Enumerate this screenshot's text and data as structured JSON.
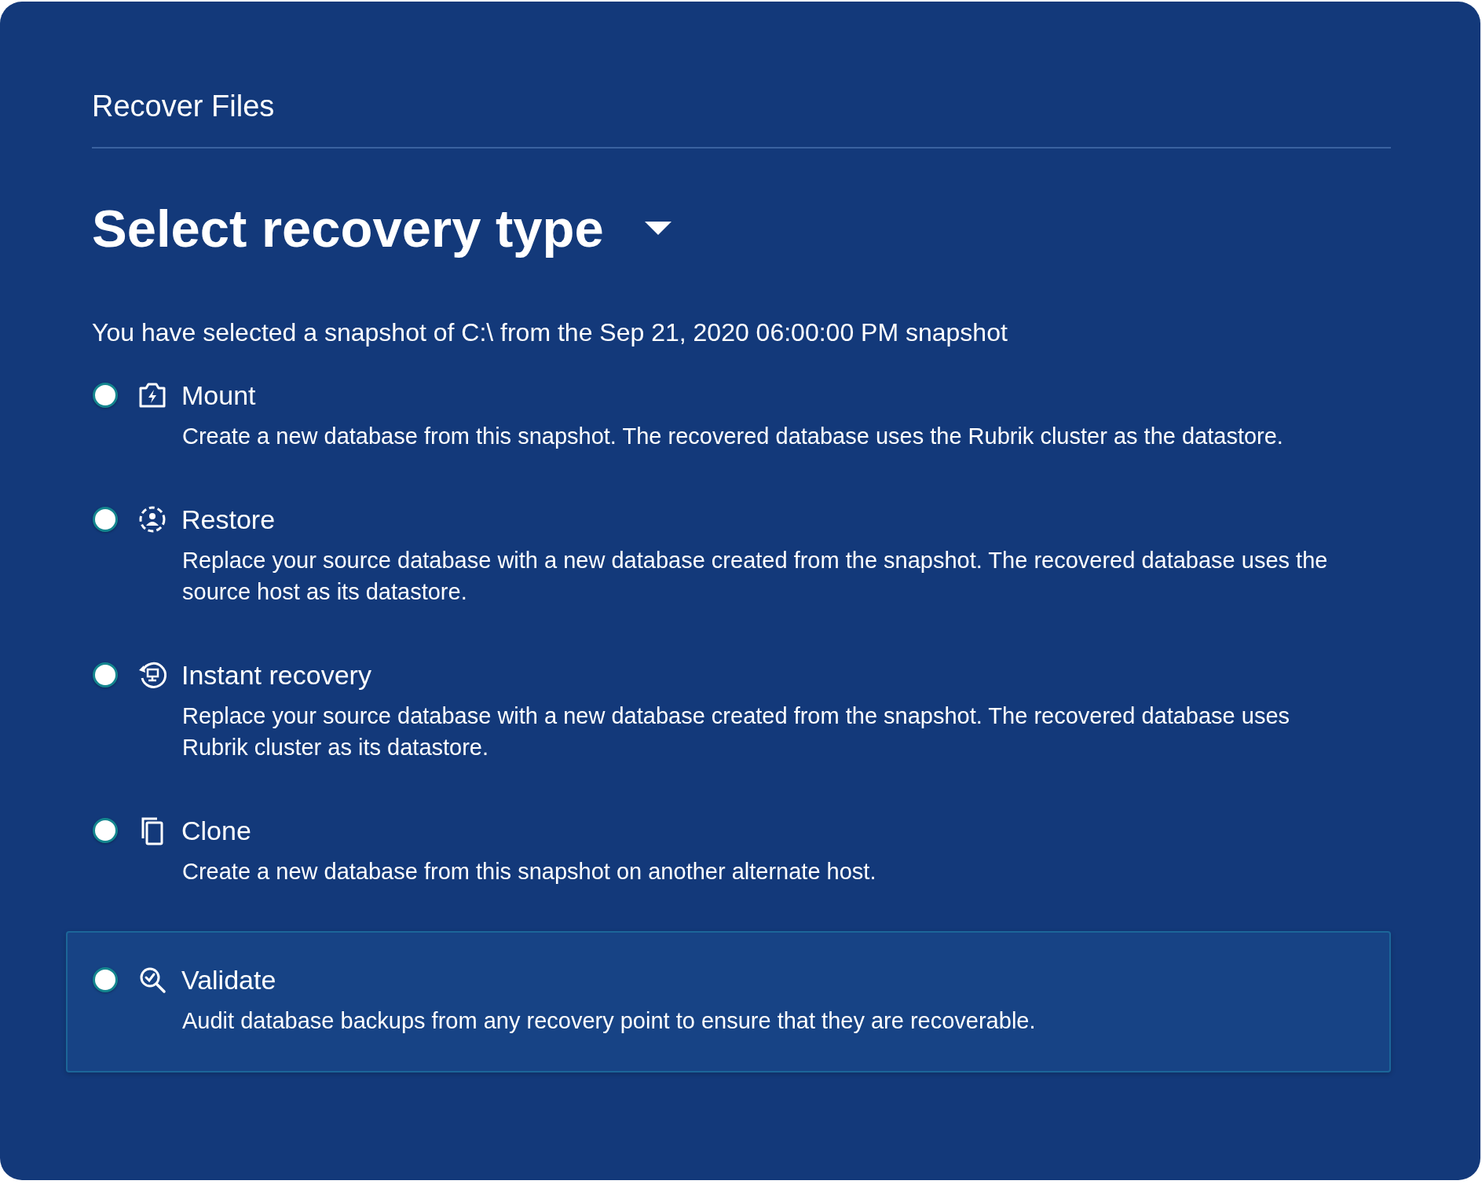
{
  "panel": {
    "title": "Recover Files"
  },
  "heading": {
    "label": "Select recovery type"
  },
  "subtitle": "You have selected a snapshot of C:\\ from the Sep 21, 2020 06:00:00 PM snapshot",
  "options": [
    {
      "kind": "mount",
      "label": "Mount",
      "description": "Create a new database from this snapshot. The recovered database uses the Rubrik cluster as the datastore.",
      "selected": false,
      "highlighted": false
    },
    {
      "kind": "restore",
      "label": "Restore",
      "description": "Replace your source database with a new database created from the snapshot. The recovered database uses the source host as its datastore.",
      "selected": false,
      "highlighted": false
    },
    {
      "kind": "instant",
      "label": "Instant recovery",
      "description": "Replace your source database with a new database created from the snapshot. The recovered database uses Rubrik cluster  as its datastore.",
      "selected": false,
      "highlighted": false
    },
    {
      "kind": "clone",
      "label": "Clone",
      "description": "Create a new database from this snapshot on another alternate host.",
      "selected": false,
      "highlighted": false
    },
    {
      "kind": "validate",
      "label": "Validate",
      "description": "Audit database backups from any recovery point to ensure that they are recoverable.",
      "selected": false,
      "highlighted": true
    }
  ]
}
